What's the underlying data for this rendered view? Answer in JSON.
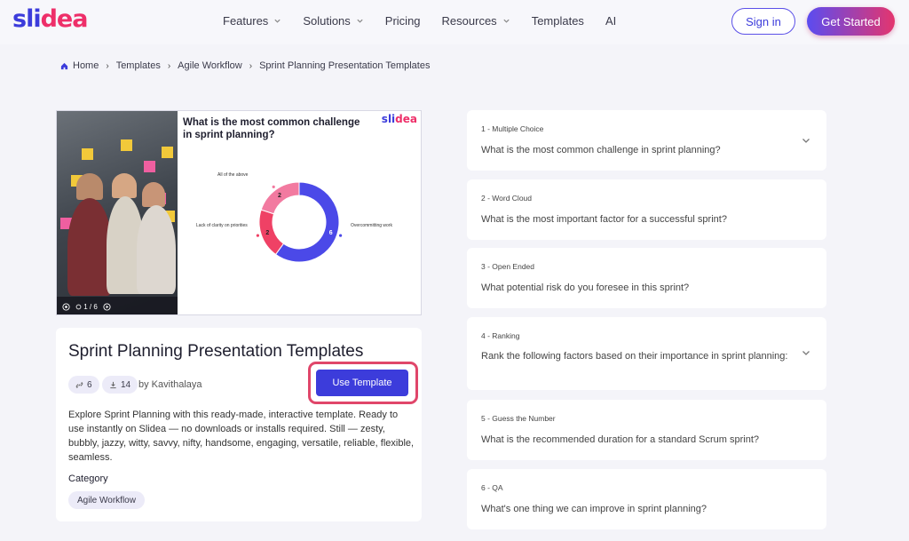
{
  "header": {
    "logo_a": "sli",
    "logo_b": "dea",
    "nav": [
      {
        "label": "Features",
        "dropdown": true
      },
      {
        "label": "Solutions",
        "dropdown": true
      },
      {
        "label": "Pricing",
        "dropdown": false
      },
      {
        "label": "Resources",
        "dropdown": true
      },
      {
        "label": "Templates",
        "dropdown": false
      },
      {
        "label": "AI",
        "dropdown": false
      }
    ],
    "sign_in": "Sign in",
    "get_started": "Get Started"
  },
  "breadcrumb": [
    "Home",
    "Templates",
    "Agile Workflow",
    "Sprint Planning Presentation Templates"
  ],
  "preview": {
    "slide_title": "What is the most common challenge in sprint planning?",
    "logo_a": "sli",
    "logo_b": "dea",
    "page_indicator": "1 / 6",
    "donut": {
      "segments": [
        {
          "label": "Overcommitting work",
          "value": 6,
          "color": "#4b49e8"
        },
        {
          "label": "Lack of clarity on priorities",
          "value": 2,
          "color": "#ef4165"
        },
        {
          "label": "All of the above",
          "value": 2,
          "color": "#f27aa0"
        }
      ]
    }
  },
  "template": {
    "title": "Sprint Planning Presentation Templates",
    "uses": "6",
    "downloads": "14",
    "author": "by Kavithalaya",
    "use_button": "Use Template",
    "description": "Explore Sprint Planning with this ready-made, interactive template. Ready to use instantly on Slidea — no downloads or installs required. Still — zesty, bubbly, jazzy, witty, savvy, nifty, handsome, engaging, versatile, reliable, flexible, seamless.",
    "category_label": "Category",
    "category": "Agile Workflow"
  },
  "questions": [
    {
      "type": "1 - Multiple Choice",
      "text": "What is the most common challenge in sprint planning?",
      "expandable": true
    },
    {
      "type": "2 - Word Cloud",
      "text": "What is the most important factor for a successful sprint?",
      "expandable": false
    },
    {
      "type": "3 - Open Ended",
      "text": "What potential risk do you foresee in this sprint?",
      "expandable": false
    },
    {
      "type": "4 - Ranking",
      "text": "Rank the following factors based on their importance in sprint planning:",
      "expandable": true
    },
    {
      "type": "5 - Guess the Number",
      "text": "What is the recommended duration for a standard Scrum sprint?",
      "expandable": false
    },
    {
      "type": "6 - QA",
      "text": "What's one thing we can improve in sprint planning?",
      "expandable": false
    }
  ]
}
